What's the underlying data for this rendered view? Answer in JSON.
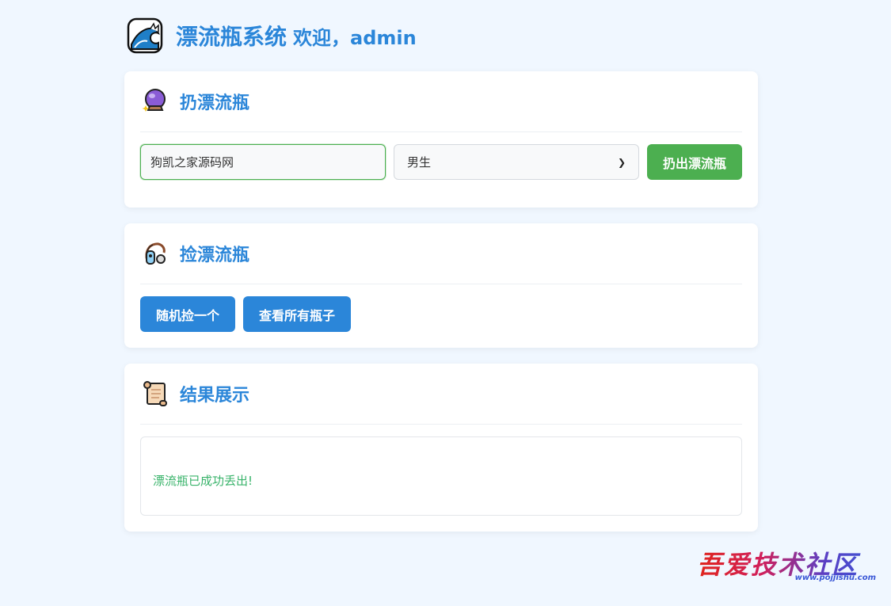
{
  "header": {
    "title": "漂流瓶系统",
    "welcome": "欢迎，admin",
    "icon": "wave-icon"
  },
  "throw_card": {
    "icon": "crystal-ball-icon",
    "heading": "扔漂流瓶",
    "input_value": "狗凯之家源码网",
    "gender_selected": "男生",
    "submit_label": "扔出漂流瓶"
  },
  "pick_card": {
    "icon": "fishing-icon",
    "heading": "捡漂流瓶",
    "random_label": "随机捡一个",
    "view_all_label": "查看所有瓶子"
  },
  "result_card": {
    "icon": "scroll-icon",
    "heading": "结果展示",
    "message": "漂流瓶已成功丢出!"
  },
  "watermark": {
    "text": "吾爱技术社区",
    "url": "www.pojjishu.com"
  },
  "colors": {
    "accent": "#2b86d9",
    "success": "#4caf50",
    "background": "#f0f7ff"
  }
}
